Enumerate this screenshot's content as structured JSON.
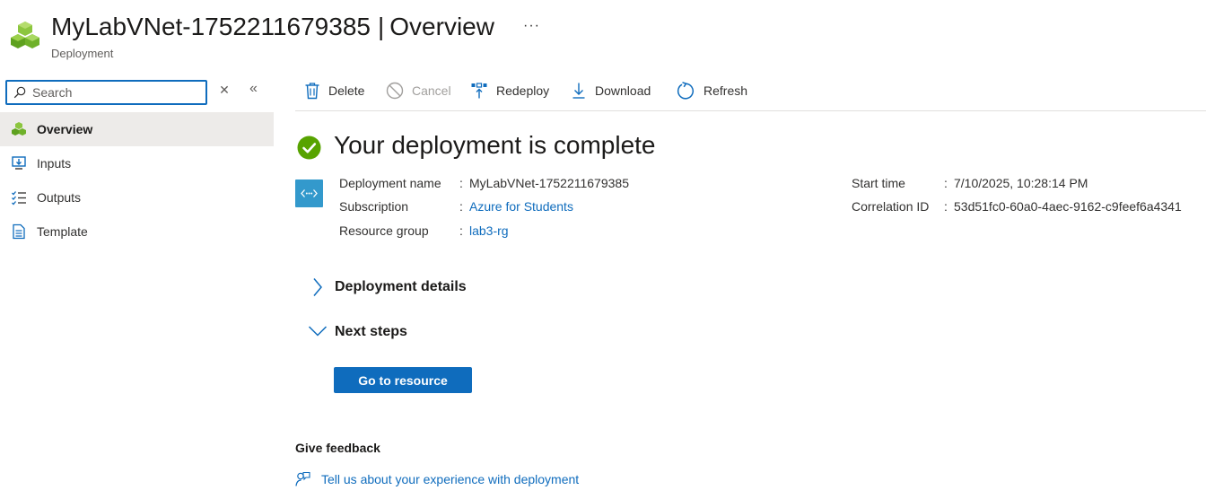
{
  "header": {
    "resource_name": "MyLabVNet-1752211679385",
    "separator": "|",
    "page_name": "Overview",
    "more_label": "···",
    "subtitle": "Deployment"
  },
  "sidebar": {
    "search_placeholder": "Search",
    "clear_label": "✕",
    "collapse_label": "«",
    "items": [
      {
        "label": "Overview",
        "icon": "deployment-cubes-icon",
        "active": true
      },
      {
        "label": "Inputs",
        "icon": "inputs-icon",
        "active": false
      },
      {
        "label": "Outputs",
        "icon": "outputs-list-icon",
        "active": false
      },
      {
        "label": "Template",
        "icon": "template-document-icon",
        "active": false
      }
    ]
  },
  "toolbar": {
    "delete_label": "Delete",
    "cancel_label": "Cancel",
    "redeploy_label": "Redeploy",
    "download_label": "Download",
    "refresh_label": "Refresh"
  },
  "status": {
    "title": "Your deployment is complete",
    "icon": "success-check-icon"
  },
  "details": {
    "deployment_name_label": "Deployment name",
    "deployment_name_value": "MyLabVNet-1752211679385",
    "subscription_label": "Subscription",
    "subscription_value": "Azure for Students",
    "resource_group_label": "Resource group",
    "resource_group_value": "lab3-rg",
    "start_time_label": "Start time",
    "start_time_value": "7/10/2025, 10:28:14 PM",
    "correlation_id_label": "Correlation ID",
    "correlation_id_value": "53d51fc0-60a0-4aec-9162-c9feef6a4341",
    "colon": ":"
  },
  "sections": {
    "deployment_details_label": "Deployment details",
    "next_steps_label": "Next steps",
    "go_to_resource_label": "Go to resource"
  },
  "feedback": {
    "title": "Give feedback",
    "link_label": "Tell us about your experience with deployment"
  },
  "colors": {
    "accent": "#0f6cbd",
    "success": "#57a300",
    "resource_green": "#7fba00",
    "deploy_icon_bg": "#3399cc"
  }
}
